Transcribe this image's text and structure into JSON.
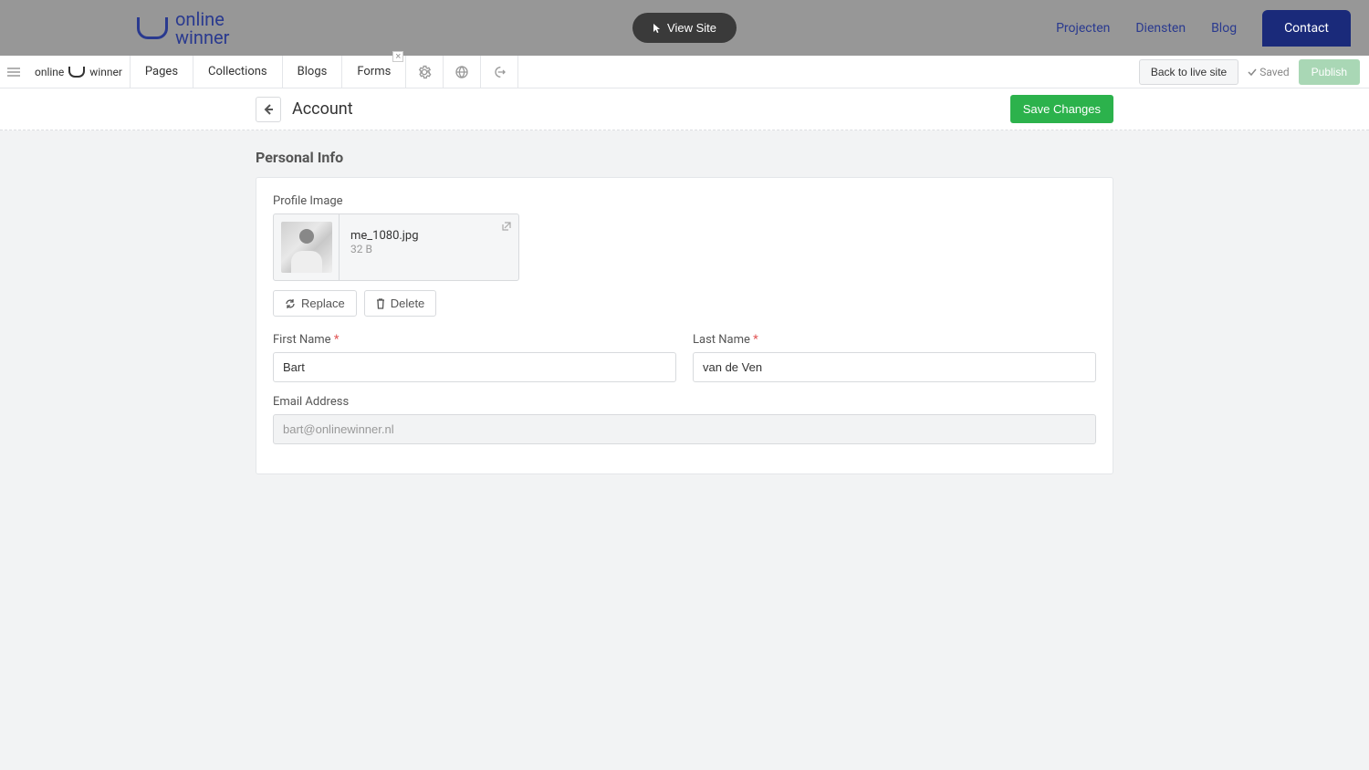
{
  "site_header": {
    "logo_line1": "online",
    "logo_line2": "winner",
    "view_site": "View Site",
    "nav": {
      "projecten": "Projecten",
      "diensten": "Diensten",
      "blog": "Blog",
      "contact": "Contact"
    }
  },
  "cms_bar": {
    "brand_a": "online",
    "brand_b": "winner",
    "tabs": {
      "pages": "Pages",
      "collections": "Collections",
      "blogs": "Blogs",
      "forms": "Forms"
    },
    "back_to_live": "Back to live site",
    "saved": "Saved",
    "publish": "Publish"
  },
  "page": {
    "title": "Account",
    "save_changes": "Save Changes",
    "section_title": "Personal Info",
    "profile_image_label": "Profile Image",
    "image_filename": "me_1080.jpg",
    "image_size": "32 B",
    "replace": "Replace",
    "delete": "Delete",
    "first_name_label": "First Name",
    "last_name_label": "Last Name",
    "email_label": "Email Address",
    "first_name_value": "Bart",
    "last_name_value": "van de Ven",
    "email_value": "bart@onlinewinner.nl"
  }
}
